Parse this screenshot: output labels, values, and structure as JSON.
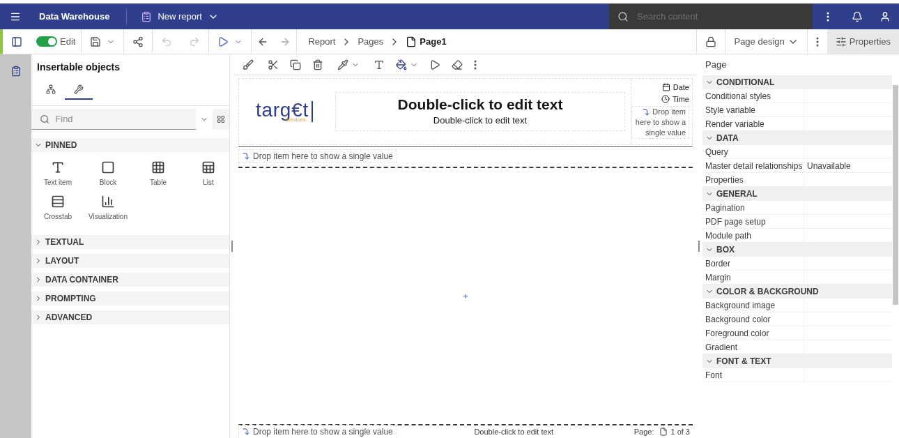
{
  "topbar": {
    "app_name": "Data Warehouse",
    "report_title": "New report",
    "search": {
      "placeholder": "Search content"
    }
  },
  "toolbar": {
    "edit_toggle": {
      "label": "Edit",
      "on": true
    },
    "breadcrumb": [
      "Report",
      "Pages",
      "Page1"
    ],
    "view_menu": "Page design",
    "properties_button": {
      "label": "Properties",
      "selected": true
    }
  },
  "insertable_objects": {
    "title": "Insertable objects",
    "tabs": [
      {
        "kind": "tree",
        "selected": false
      },
      {
        "kind": "tools",
        "selected": true
      }
    ],
    "find": {
      "placeholder": "Find"
    },
    "sections": [
      {
        "label": "PINNED",
        "expanded": true,
        "items": [
          {
            "kind": "text",
            "label": "Text item"
          },
          {
            "kind": "block",
            "label": "Block"
          },
          {
            "kind": "table",
            "label": "Table"
          },
          {
            "kind": "list",
            "label": "List"
          },
          {
            "kind": "crosstab",
            "label": "Crosstab"
          },
          {
            "kind": "chart",
            "label": "Visualization"
          }
        ]
      },
      {
        "label": "TEXTUAL",
        "expanded": false
      },
      {
        "label": "LAYOUT",
        "expanded": false
      },
      {
        "label": "DATA CONTAINER",
        "expanded": false
      },
      {
        "label": "PROMPTING",
        "expanded": false
      },
      {
        "label": "ADVANCED",
        "expanded": false
      }
    ]
  },
  "canvas": {
    "logo": {
      "word": "targ€t",
      "tagline": "services"
    },
    "title": "Double-click to edit text",
    "subtitle": "Double-click to edit text",
    "date": "Date",
    "time": "Time",
    "side_drop": "Drop item here to show a single value",
    "header_drop": "Drop item here to show a single value",
    "body_marker": "+",
    "footer": {
      "drop": "Drop item here to show a single value",
      "text": "Double-click to edit text",
      "page_label": "Page:",
      "page_count": "1 of 3"
    }
  },
  "properties": {
    "title": "Page",
    "groups": [
      {
        "label": "CONDITIONAL",
        "expanded": true,
        "rows": [
          {
            "name": "Conditional styles"
          },
          {
            "name": "Style variable"
          },
          {
            "name": "Render variable"
          }
        ]
      },
      {
        "label": "DATA",
        "expanded": true,
        "rows": [
          {
            "name": "Query"
          },
          {
            "name": "Master detail relationships",
            "value": "Unavailable"
          },
          {
            "name": "Properties"
          }
        ]
      },
      {
        "label": "GENERAL",
        "expanded": true,
        "rows": [
          {
            "name": "Pagination"
          },
          {
            "name": "PDF page setup"
          },
          {
            "name": "Module path"
          }
        ]
      },
      {
        "label": "BOX",
        "expanded": true,
        "rows": [
          {
            "name": "Border"
          },
          {
            "name": "Margin"
          }
        ]
      },
      {
        "label": "COLOR & BACKGROUND",
        "expanded": true,
        "rows": [
          {
            "name": "Background image"
          },
          {
            "name": "Background color"
          },
          {
            "name": "Foreground color"
          },
          {
            "name": "Gradient"
          }
        ]
      },
      {
        "label": "FONT & TEXT",
        "expanded": true,
        "rows": [
          {
            "name": "Font"
          }
        ]
      }
    ]
  }
}
